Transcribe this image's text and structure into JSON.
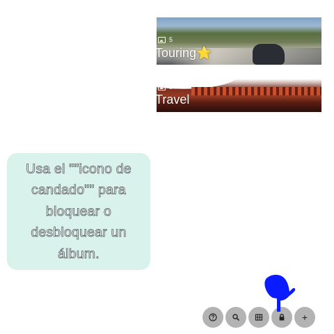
{
  "albums": [
    {
      "name": "Touring⭐",
      "count": "5",
      "icon": "photo-icon"
    },
    {
      "name": "Travel",
      "count": "5",
      "icon": "photo-icon"
    }
  ],
  "hint": {
    "text": "Usa el \"\"icono de candado\"\" para bloquear o desbloquear un álbum."
  },
  "toolbar": {
    "buttons": [
      {
        "icon": "help-icon"
      },
      {
        "icon": "search-icon"
      },
      {
        "icon": "grid-icon"
      },
      {
        "icon": "lock-icon"
      },
      {
        "label": "+",
        "icon": "plus-icon"
      }
    ]
  },
  "colors": {
    "hint_bg": "#d9f3ec",
    "fab_bg": "#b3b3b3",
    "pointer": "#0a1cff"
  }
}
